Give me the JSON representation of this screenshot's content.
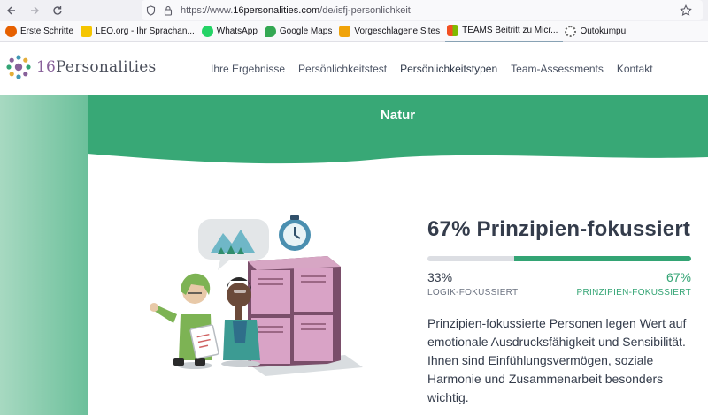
{
  "browser": {
    "url_prefix": "https://www.",
    "url_domain": "16personalities.com",
    "url_path": "/de/isfj-personlichkeit"
  },
  "bookmarks": [
    {
      "label": "Erste Schritte",
      "color": "#e66000"
    },
    {
      "label": "LEO.org - Ihr Sprachan...",
      "color": "#f5c500"
    },
    {
      "label": "WhatsApp",
      "color": "#25d366"
    },
    {
      "label": "Google Maps",
      "color": "#34a853"
    },
    {
      "label": "Vorgeschlagene Sites",
      "color": "#f0a30a"
    },
    {
      "label": "TEAMS Beitritt zu Micr...",
      "color": "#ea4335"
    },
    {
      "label": "Outokumpu",
      "color": "#6b6b6b"
    }
  ],
  "logo": {
    "number": "16",
    "word": "Personalities"
  },
  "nav": [
    {
      "label": "Ihre Ergebnisse"
    },
    {
      "label": "Persönlichkeitstest"
    },
    {
      "label": "Persönlichkeitstypen"
    },
    {
      "label": "Team-Assessments"
    },
    {
      "label": "Kontakt"
    }
  ],
  "section": {
    "title": "Natur"
  },
  "trait": {
    "title": "67% Prinzipien-fokussiert",
    "fill_percent": 67,
    "left_percent": "33%",
    "right_percent": "67%",
    "left_label": "LOGIK-FOKUSSIERT",
    "right_label": "PRINZIPIEN-FOKUSSIERT",
    "description": "Prinzipien-fokussierte Personen legen Wert auf emotionale Ausdrucksfähigkeit und Sensibilität. Ihnen sind Einfühlungsvermögen, soziale Harmonie und Zusammenarbeit besonders wichtig."
  },
  "colors": {
    "brand_green": "#33a474",
    "band_green": "#38a876",
    "logo_purple": "#88619a"
  }
}
